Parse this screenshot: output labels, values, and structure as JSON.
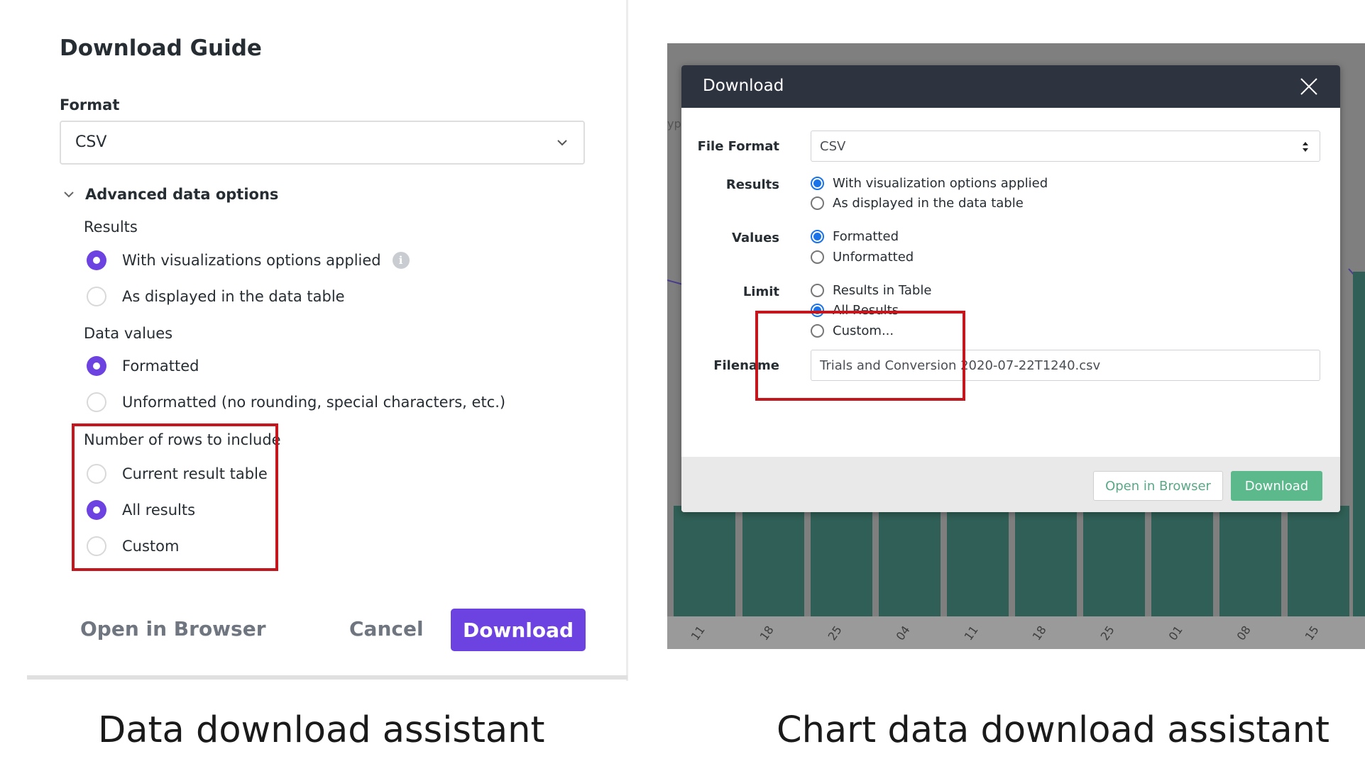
{
  "left": {
    "title": "Download Guide",
    "format_label": "Format",
    "format_value": "CSV",
    "advanced_label": "Advanced data options",
    "results_label": "Results",
    "results_options": [
      "With visualizations options applied",
      "As displayed in the data table"
    ],
    "results_selected": 0,
    "data_values_label": "Data values",
    "data_values_options": [
      "Formatted",
      "Unformatted (no rounding, special characters, etc.)"
    ],
    "data_values_selected": 0,
    "rows_label": "Number of rows to include",
    "rows_options": [
      "Current result table",
      "All results",
      "Custom"
    ],
    "rows_selected": 1,
    "open_browser_label": "Open in Browser",
    "cancel_label": "Cancel",
    "download_label": "Download",
    "accent_color": "#6c43e0",
    "highlight_color": "#c4161c"
  },
  "right": {
    "modal_title": "Download",
    "file_format_label": "File Format",
    "file_format_value": "CSV",
    "results_label": "Results",
    "results_options": [
      "With visualization options applied",
      "As displayed in the data table"
    ],
    "results_selected": 0,
    "values_label": "Values",
    "values_options": [
      "Formatted",
      "Unformatted"
    ],
    "values_selected": 0,
    "limit_label": "Limit",
    "limit_options": [
      "Results in Table",
      "All Results",
      "Custom..."
    ],
    "limit_selected": 1,
    "filename_label": "Filename",
    "filename_value": "Trials and Conversion 2020-07-22T1240.csv",
    "open_browser_label": "Open in Browser",
    "download_label": "Download",
    "background_fragment": "yp",
    "background_ticks": [
      "11",
      "18",
      "25",
      "04",
      "11",
      "18",
      "25",
      "01",
      "08",
      "15"
    ],
    "accent_color": "#5bb98c",
    "radio_color": "#1a73e8"
  },
  "captions": {
    "left": "Data download assistant",
    "right": "Chart data download assistant"
  }
}
